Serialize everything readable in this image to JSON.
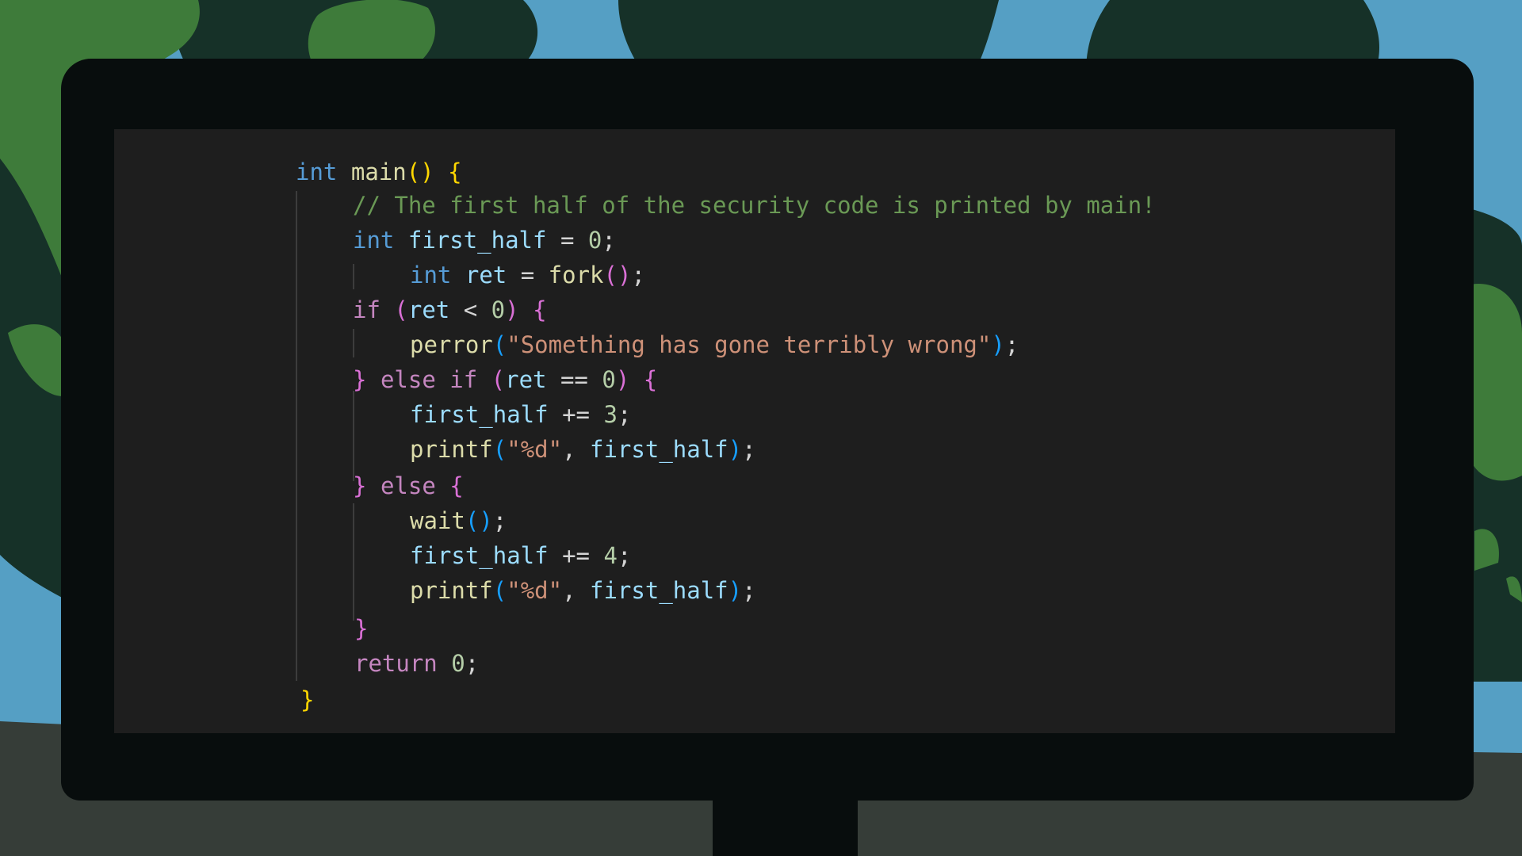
{
  "code": {
    "line1": [
      "int",
      "main",
      "(",
      ")",
      "{"
    ],
    "line2": "// The first half of the security code is printed by main!",
    "line3": [
      "int",
      "first_half",
      "=",
      "0",
      ";"
    ],
    "line4": [
      "int",
      "ret",
      "=",
      "fork",
      "(",
      ")",
      ";"
    ],
    "line5": [
      "if",
      "(",
      "ret",
      "<",
      "0",
      ")",
      "{"
    ],
    "line6": [
      "perror",
      "(",
      "\"Something has gone terribly wrong\"",
      ")",
      ";"
    ],
    "line7": [
      "}",
      "else",
      "if",
      "(",
      "ret",
      "==",
      "0",
      ")",
      "{"
    ],
    "line8": [
      "first_half",
      "+=",
      "3",
      ";"
    ],
    "line9": [
      "printf",
      "(",
      "\"%d\"",
      ",",
      "first_half",
      ")",
      ";"
    ],
    "line10": [
      "}",
      "else",
      "{"
    ],
    "line11": [
      "wait",
      "(",
      ")",
      ";"
    ],
    "line12": [
      "first_half",
      "+=",
      "4",
      ";"
    ],
    "line13": [
      "printf",
      "(",
      "\"%d\"",
      ",",
      "first_half",
      ")",
      ";"
    ],
    "line14": [
      "}"
    ],
    "line15": [
      "return",
      "0",
      ";"
    ],
    "line16": [
      "}"
    ]
  },
  "colors": {
    "sky": "#559fc4",
    "foliage_light": "#3e7b3a",
    "foliage_dark": "#163128",
    "ground": "#363d38",
    "monitor_bezel": "#080d0d",
    "editor_background": "#1e1e1e"
  }
}
